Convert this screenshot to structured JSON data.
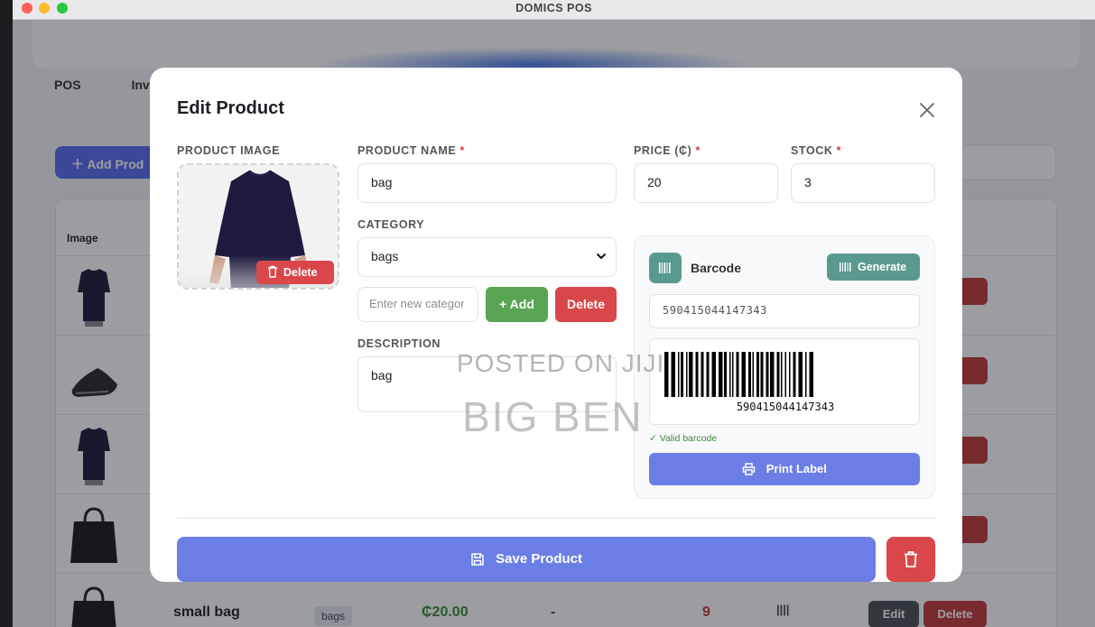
{
  "window": {
    "title": "DOMICS POS"
  },
  "background": {
    "tabs": [
      "POS",
      "Inv"
    ],
    "add_product_label": "＋ Add Prod",
    "table_header_image": "Image",
    "last_row": {
      "name": "small bag",
      "category": "bags",
      "price": "₵20.00",
      "dash": "-",
      "stock": "9",
      "barcode_glyph": "||||",
      "edit_label": "Edit",
      "delete_label": "Delete"
    },
    "partial_delete_label": "ete"
  },
  "modal": {
    "title": "Edit Product",
    "labels": {
      "product_image": "PRODUCT IMAGE",
      "product_name": "PRODUCT NAME",
      "price": "PRICE (₵)",
      "stock": "STOCK",
      "category": "CATEGORY",
      "description": "DESCRIPTION",
      "required_mark": "*"
    },
    "image_delete_label": "Delete",
    "fields": {
      "product_name": "bag",
      "price": "20",
      "stock": "3",
      "category_selected": "bags",
      "new_category_placeholder": "Enter new categor",
      "description": "bag"
    },
    "category_buttons": {
      "add": "+ Add",
      "delete": "Delete"
    },
    "barcode": {
      "title": "Barcode",
      "generate_label": "Generate",
      "value": "590415044147343",
      "image_number": "590415044147343",
      "valid_text": "✓ Valid barcode",
      "print_label": "Print Label"
    },
    "save_label": "Save Product"
  },
  "watermark": {
    "line1": "POSTED ON JIJI",
    "line2": "BIG BEN"
  },
  "colors": {
    "primary": "#6b7ee5",
    "danger": "#d9474a",
    "success": "#5aa554",
    "teal": "#5a9a8e"
  }
}
